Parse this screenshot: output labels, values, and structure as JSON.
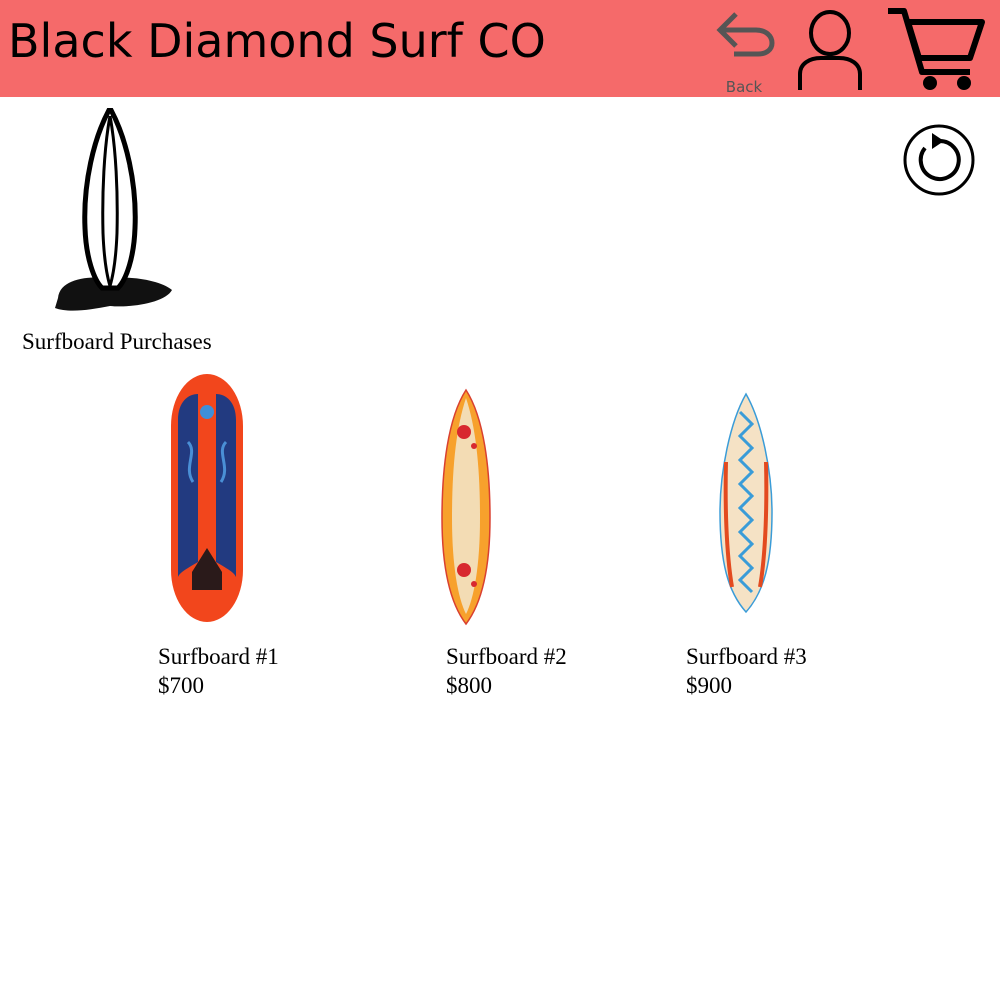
{
  "header": {
    "brand": "Black Diamond Surf CO",
    "back_label": "Back",
    "background_color": "#f56a6a"
  },
  "icons": {
    "back": "back-arrow-icon",
    "user": "user-icon",
    "cart": "shopping-cart-icon",
    "refresh": "refresh-icon",
    "logo": "surfboard-logo-icon"
  },
  "section": {
    "title": "Surfboard Purchases"
  },
  "products": [
    {
      "name": "Surfboard #1",
      "price": "$700"
    },
    {
      "name": "Surfboard #2",
      "price": "$800"
    },
    {
      "name": "Surfboard #3",
      "price": "$900"
    }
  ]
}
